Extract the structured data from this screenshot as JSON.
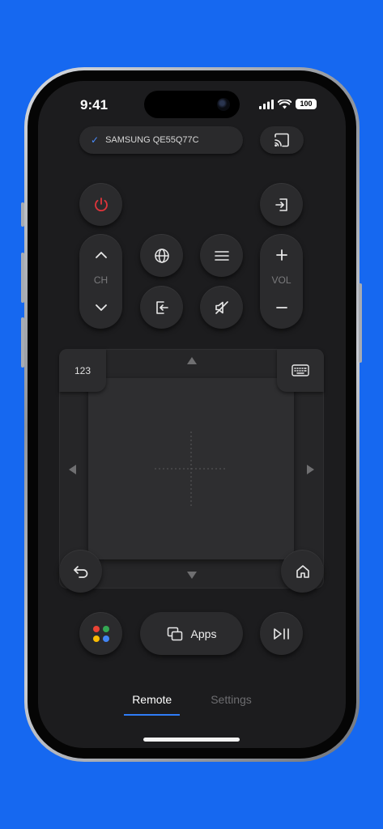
{
  "status": {
    "time": "9:41",
    "battery": "100"
  },
  "device": {
    "name": "SAMSUNG QE55Q77C",
    "check": "✓"
  },
  "remote": {
    "channel_label": "CH",
    "volume_label": "VOL",
    "keypad_label": "123",
    "apps_label": "Apps",
    "power_color": "#e0353b"
  },
  "google_dots": [
    "#ea4335",
    "#34a853",
    "#fbbc04",
    "#4285f4"
  ],
  "icons": {
    "cast": "cast-icon",
    "power": "power-icon",
    "input": "input-icon",
    "globe": "globe-icon",
    "menu": "menu-icon",
    "source": "source-icon",
    "mute": "mute-icon",
    "keyboard": "keyboard-icon",
    "back": "back-icon",
    "home": "home-icon",
    "play_pause": "play-pause-icon",
    "apps": "apps-icon"
  },
  "tabs": [
    {
      "label": "Remote",
      "active": true
    },
    {
      "label": "Settings",
      "active": false
    }
  ]
}
